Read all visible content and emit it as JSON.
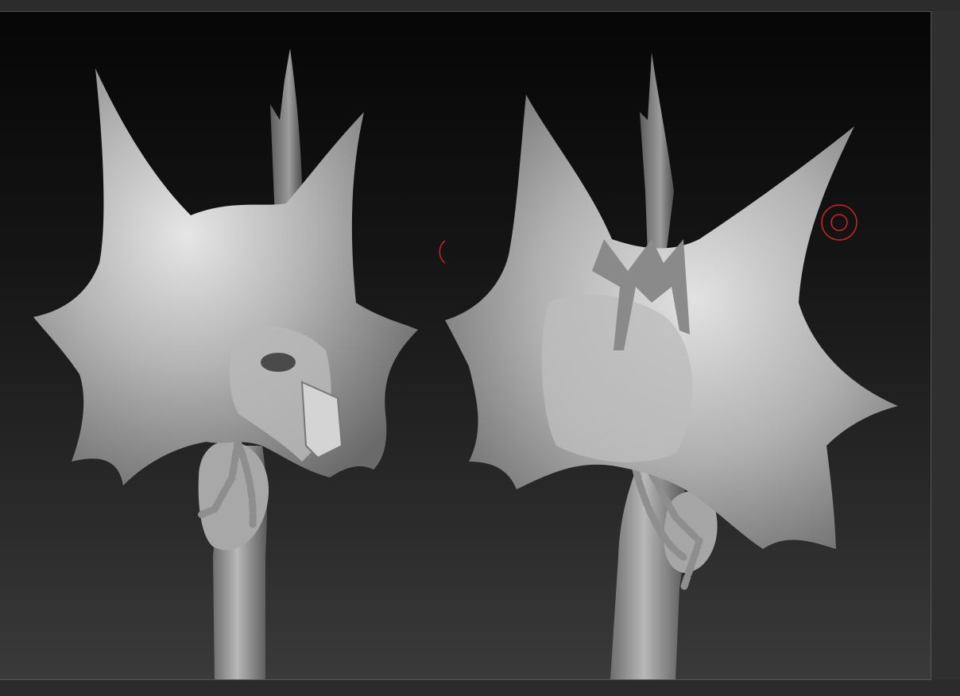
{
  "app": {
    "window": "3d-sculpting-viewport"
  },
  "viewport": {
    "models": [
      {
        "name": "mace-head-front-view"
      },
      {
        "name": "mace-head-back-view"
      }
    ],
    "brush_cursors": [
      {
        "name": "draw-brush-cursor",
        "color": "#cc2222"
      },
      {
        "name": "partial-brush-cursor",
        "color": "#cc2222"
      }
    ],
    "colors": {
      "background_top": "#060606",
      "background_bottom": "#3a3a3a",
      "material": "#c8c8c8"
    }
  }
}
